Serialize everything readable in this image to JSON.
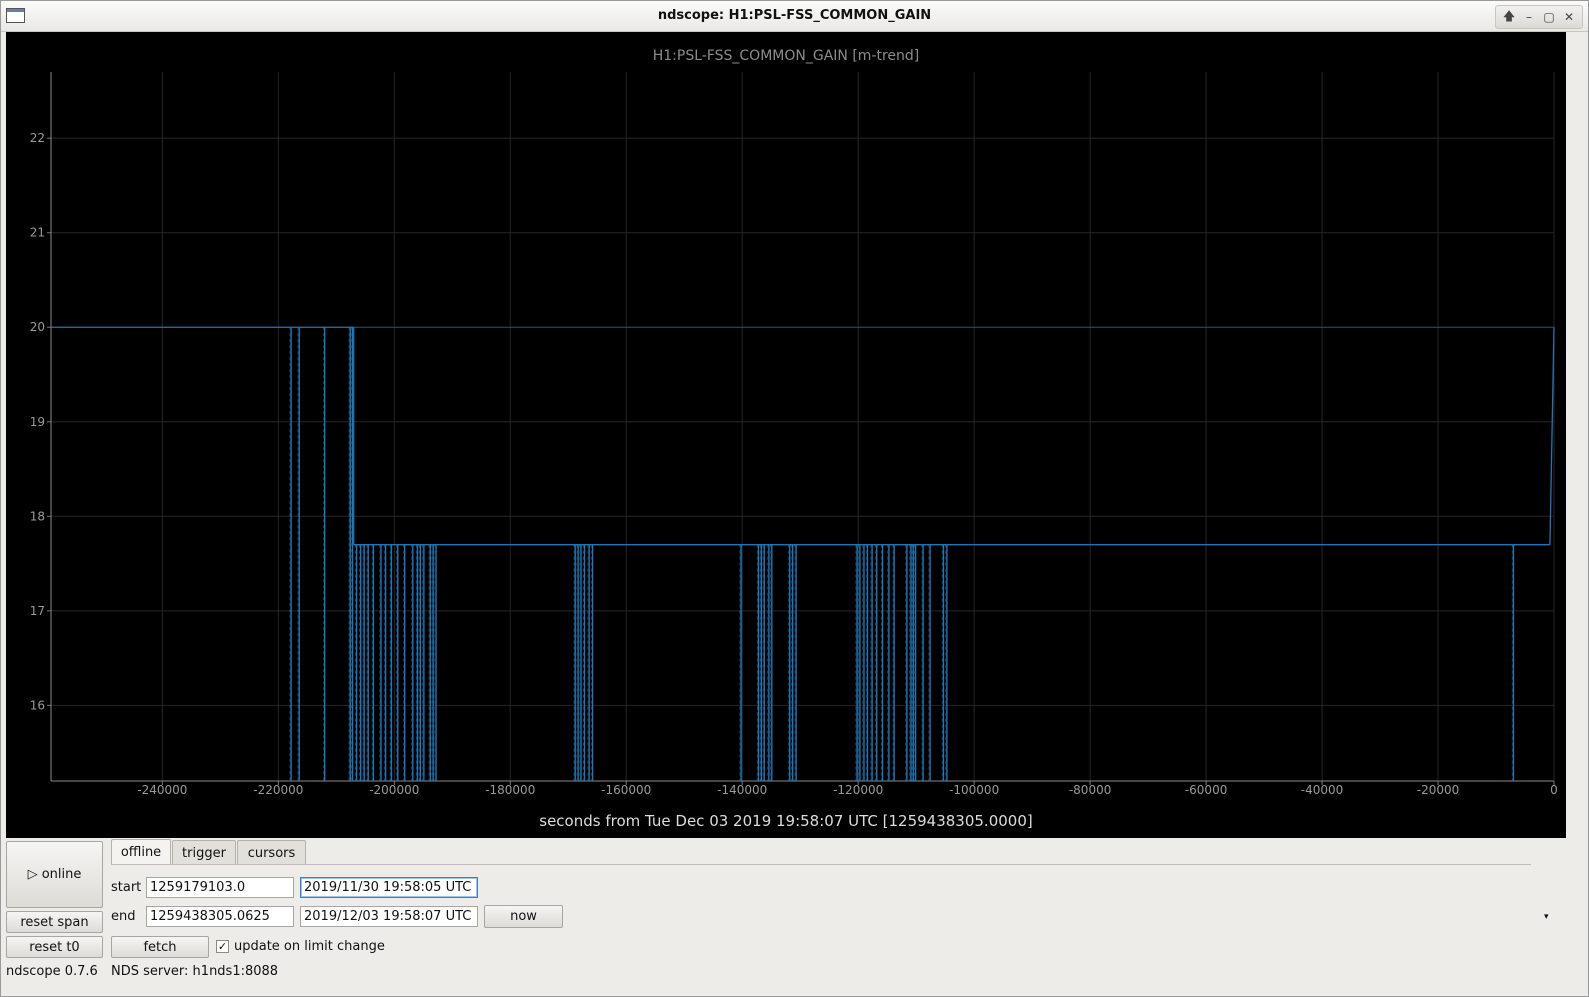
{
  "window": {
    "title": "ndscope: H1:PSL-FSS_COMMON_GAIN",
    "buttons": [
      "🡅",
      "–",
      "▢",
      "✕"
    ]
  },
  "chart_data": {
    "type": "line",
    "title": "H1:PSL-FSS_COMMON_GAIN [m-trend]",
    "xlabel": "seconds from Tue Dec 03 2019 19:58:07 UTC [1259438305.0000]",
    "ylabel": "",
    "xlim": [
      -259202,
      0
    ],
    "ylim": [
      15.2,
      22.7
    ],
    "grid": true,
    "line_color": "#1f77b4",
    "x_ticks": [
      "-240000",
      "-220000",
      "-200000",
      "-180000",
      "-160000",
      "-140000",
      "-120000",
      "-100000",
      "-80000",
      "-60000",
      "-40000",
      "-20000",
      "0"
    ],
    "x_tick_values": [
      -240000,
      -220000,
      -200000,
      -180000,
      -160000,
      -140000,
      -120000,
      -100000,
      -80000,
      -60000,
      -40000,
      -20000,
      0
    ],
    "y_ticks": [
      "16",
      "17",
      "18",
      "19",
      "20",
      "21",
      "22"
    ],
    "y_tick_values": [
      16,
      17,
      18,
      19,
      20,
      21,
      22
    ],
    "series": [
      {
        "segments": [
          {
            "x": [
              -259202,
              -207000
            ],
            "y": [
              20,
              20
            ]
          },
          {
            "x": [
              -207000,
              -700
            ],
            "y": [
              17.7,
              17.7
            ]
          },
          {
            "x": [
              -700,
              0
            ],
            "y": [
              17.7,
              20
            ]
          }
        ],
        "max_envelope": {
          "x": [
            -207000,
            0
          ],
          "y": [
            20,
            20
          ]
        },
        "dropouts": [
          -217800,
          -216400,
          -212000,
          -207600,
          -207200,
          -206500,
          -205800,
          -205200,
          -204500,
          -203600,
          -202300,
          -201500,
          -200500,
          -199400,
          -198200,
          -196800,
          -196000,
          -195500,
          -194900,
          -193800,
          -193300,
          -192800,
          -168800,
          -168300,
          -167800,
          -167200,
          -166400,
          -165800,
          -140200,
          -137200,
          -136700,
          -136200,
          -135400,
          -134900,
          -131800,
          -131300,
          -130700,
          -120200,
          -119700,
          -119000,
          -118400,
          -117600,
          -116800,
          -115800,
          -114700,
          -113800,
          -111600,
          -110900,
          -110500,
          -110100,
          -108800,
          -107600,
          -105300,
          -104700,
          -7000
        ]
      }
    ]
  },
  "controls": {
    "online_label": "▷ online",
    "reset_span_label": "reset span",
    "reset_t0_label": "reset t0",
    "tabs": [
      "offline",
      "trigger",
      "cursors"
    ],
    "start_label": "start",
    "start_gps": "1259179103.0",
    "start_utc": "2019/11/30 19:58:05 UTC",
    "end_label": "end",
    "end_gps": "1259438305.0625",
    "end_utc": "2019/12/03 19:58:07 UTC",
    "now_label": "now",
    "fetch_label": "fetch",
    "update_checkbox_mark": "✓",
    "update_label": "update on limit change",
    "expand_arrow": "▾"
  },
  "status": {
    "version": "ndscope 0.7.6",
    "server": "NDS server: h1nds1:8088"
  }
}
